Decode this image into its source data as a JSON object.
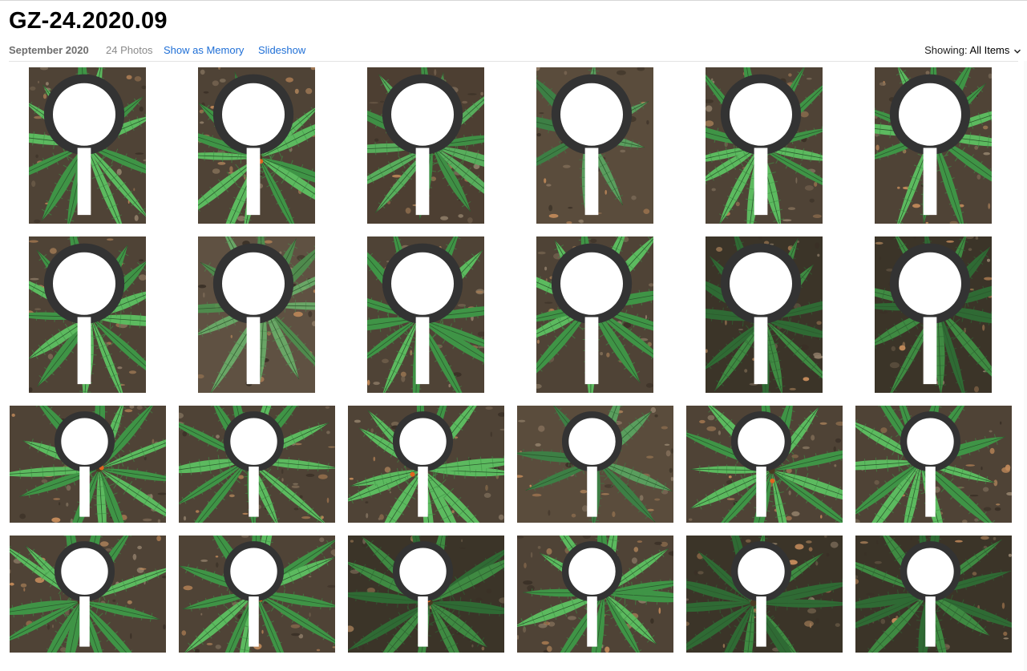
{
  "album": {
    "title": "GZ-24.2020.09",
    "date": "September 2020",
    "count": "24 Photos",
    "show_as_memory": "Show as Memory",
    "slideshow": "Slideshow"
  },
  "filter": {
    "label": "Showing:",
    "value": "All Items"
  },
  "colors": {
    "link": "#1f6fd6",
    "fern_light": "#4fa552",
    "fern_dark": "#2f6a34",
    "soil": "#5a4a3a"
  },
  "photos": [
    {
      "index": 1,
      "orientation": "portrait",
      "style": "bright"
    },
    {
      "index": 2,
      "orientation": "portrait",
      "style": "bright"
    },
    {
      "index": 3,
      "orientation": "portrait",
      "style": "soil"
    },
    {
      "index": 4,
      "orientation": "portrait",
      "style": "sparse"
    },
    {
      "index": 5,
      "orientation": "portrait",
      "style": "bright"
    },
    {
      "index": 6,
      "orientation": "portrait",
      "style": "bright"
    },
    {
      "index": 7,
      "orientation": "portrait",
      "style": "bright"
    },
    {
      "index": 8,
      "orientation": "portrait",
      "style": "blurry"
    },
    {
      "index": 9,
      "orientation": "portrait",
      "style": "bright"
    },
    {
      "index": 10,
      "orientation": "portrait",
      "style": "bright"
    },
    {
      "index": 11,
      "orientation": "portrait",
      "style": "dark"
    },
    {
      "index": 12,
      "orientation": "portrait",
      "style": "dark"
    },
    {
      "index": 13,
      "orientation": "landscape",
      "style": "bright"
    },
    {
      "index": 14,
      "orientation": "landscape",
      "style": "bright"
    },
    {
      "index": 15,
      "orientation": "landscape",
      "style": "bright"
    },
    {
      "index": 16,
      "orientation": "landscape",
      "style": "sparse"
    },
    {
      "index": 17,
      "orientation": "landscape",
      "style": "bright"
    },
    {
      "index": 18,
      "orientation": "landscape",
      "style": "bright"
    },
    {
      "index": 19,
      "orientation": "landscape",
      "style": "bright"
    },
    {
      "index": 20,
      "orientation": "landscape",
      "style": "bright"
    },
    {
      "index": 21,
      "orientation": "landscape",
      "style": "dark"
    },
    {
      "index": 22,
      "orientation": "landscape",
      "style": "bright"
    },
    {
      "index": 23,
      "orientation": "landscape",
      "style": "dark"
    },
    {
      "index": 24,
      "orientation": "landscape",
      "style": "dark"
    }
  ]
}
